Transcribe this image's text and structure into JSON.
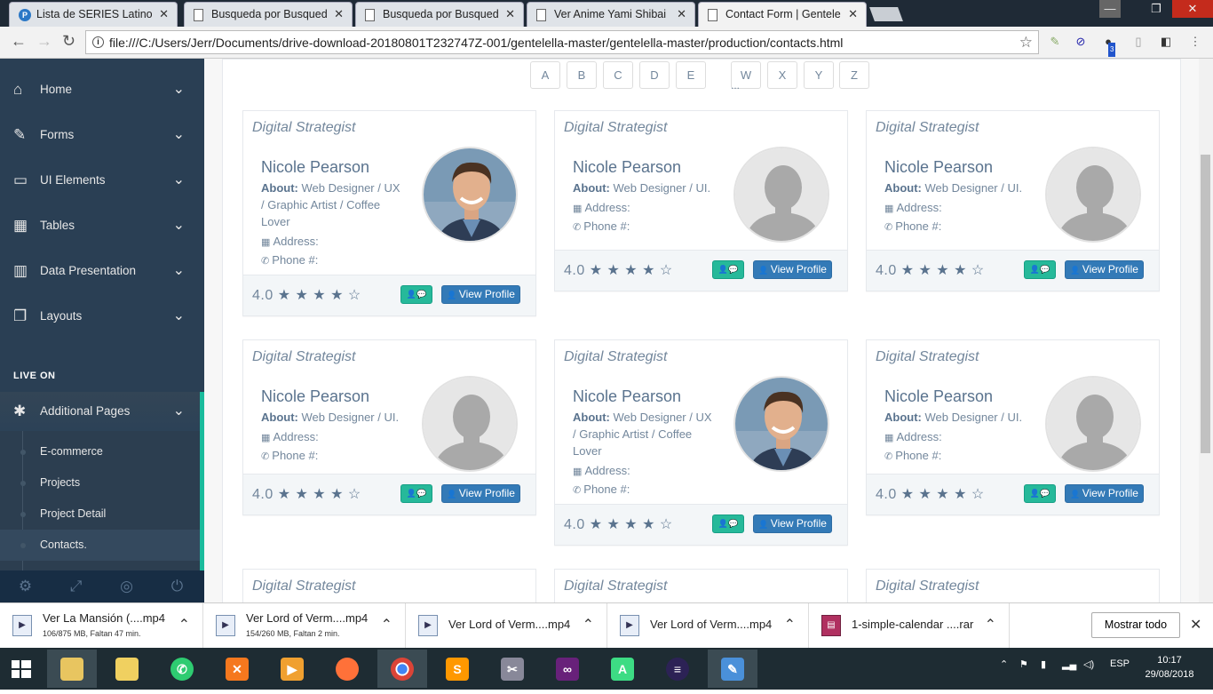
{
  "browser": {
    "tabs": [
      {
        "title": "Lista de SERIES Latino, Ca",
        "favicon": "blue"
      },
      {
        "title": "Busqueda por Busqueda:",
        "favicon": "doc"
      },
      {
        "title": "Busqueda por Busqueda:",
        "favicon": "doc"
      },
      {
        "title": "Ver Anime Yami Shibai O",
        "favicon": "doc"
      },
      {
        "title": "Contact Form | Gentelella",
        "favicon": "doc"
      }
    ],
    "url": "file:///C:/Users/Jerr/Documents/drive-download-20180801T232747Z-001/gentelella-master/gentelella-master/production/contacts.html",
    "info_icon": "i"
  },
  "sidebar": {
    "menu": [
      {
        "label": "Home",
        "icon": "home-icon"
      },
      {
        "label": "Forms",
        "icon": "edit-icon"
      },
      {
        "label": "UI Elements",
        "icon": "desktop-icon"
      },
      {
        "label": "Tables",
        "icon": "table-icon"
      },
      {
        "label": "Data Presentation",
        "icon": "bar-chart-icon"
      },
      {
        "label": "Layouts",
        "icon": "clone-icon"
      }
    ],
    "section_title": "LIVE ON",
    "additional_pages": "Additional Pages",
    "submenu": [
      "E-commerce",
      "Projects",
      "Project Detail",
      "Contacts."
    ]
  },
  "alphabet": [
    "A",
    "B",
    "C",
    "D",
    "E",
    "W",
    "X",
    "Y",
    "Z"
  ],
  "alphabet_ellipsis": "...",
  "cards": [
    {
      "role": "Digital Strategist",
      "name": "Nicole Pearson",
      "about_label": "About:",
      "about": "Web Designer / UX / Graphic Artist / Coffee Lover",
      "address": "Address:",
      "phone": "Phone #:",
      "rating": "4.0",
      "stars": 4,
      "photo": true,
      "view_label": "View Profile"
    },
    {
      "role": "Digital Strategist",
      "name": "Nicole Pearson",
      "about_label": "About:",
      "about": "Web Designer / UI.",
      "address": "Address:",
      "phone": "Phone #:",
      "rating": "4.0",
      "stars": 4,
      "photo": false,
      "view_label": "View Profile"
    },
    {
      "role": "Digital Strategist",
      "name": "Nicole Pearson",
      "about_label": "About:",
      "about": "Web Designer / UI.",
      "address": "Address:",
      "phone": "Phone #:",
      "rating": "4.0",
      "stars": 4,
      "photo": false,
      "view_label": "View Profile"
    },
    {
      "role": "Digital Strategist",
      "name": "Nicole Pearson",
      "about_label": "About:",
      "about": "Web Designer / UI.",
      "address": "Address:",
      "phone": "Phone #:",
      "rating": "4.0",
      "stars": 4,
      "photo": false,
      "view_label": "View Profile"
    },
    {
      "role": "Digital Strategist",
      "name": "Nicole Pearson",
      "about_label": "About:",
      "about": "Web Designer / UX / Graphic Artist / Coffee Lover",
      "address": "Address:",
      "phone": "Phone #:",
      "rating": "4.0",
      "stars": 4,
      "photo": true,
      "view_label": "View Profile"
    },
    {
      "role": "Digital Strategist",
      "name": "Nicole Pearson",
      "about_label": "About:",
      "about": "Web Designer / UI.",
      "address": "Address:",
      "phone": "Phone #:",
      "rating": "4.0",
      "stars": 4,
      "photo": false,
      "view_label": "View Profile"
    },
    {
      "role": "Digital Strategist"
    },
    {
      "role": "Digital Strategist"
    },
    {
      "role": "Digital Strategist"
    }
  ],
  "downloads": [
    {
      "name": "Ver La Mansión (....mp4",
      "status": "106/875 MB, Faltan 47 min."
    },
    {
      "name": "Ver Lord of Verm....mp4",
      "status": "154/260 MB, Faltan 2 min."
    },
    {
      "name": "Ver Lord of Verm....mp4",
      "status": ""
    },
    {
      "name": "Ver Lord of Verm....mp4",
      "status": ""
    },
    {
      "name": "1-simple-calendar ....rar",
      "status": ""
    }
  ],
  "show_all": "Mostrar todo",
  "taskbar": {
    "lang": "ESP",
    "time": "10:17",
    "date": "29/08/2018",
    "badge": "3"
  }
}
